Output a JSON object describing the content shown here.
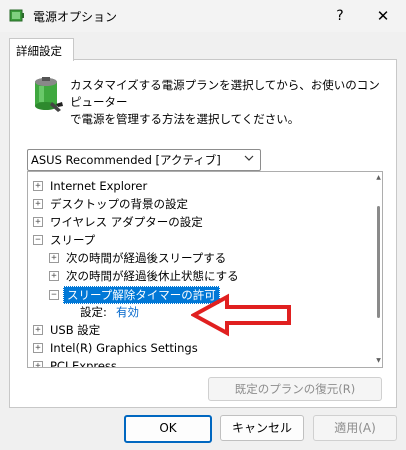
{
  "window": {
    "title": "電源オプション",
    "help_glyph": "?",
    "close_glyph": "✕"
  },
  "tab": {
    "label": "詳細設定"
  },
  "description": {
    "line1": "カスタマイズする電源プランを選択してから、お使いのコンピューター",
    "line2": "で電源を管理する方法を選択してください。"
  },
  "plan_select": {
    "value": "ASUS Recommended [アクティブ]"
  },
  "tree": {
    "items": [
      {
        "label": "Internet Explorer",
        "expander": "+"
      },
      {
        "label": "デスクトップの背景の設定",
        "expander": "+"
      },
      {
        "label": "ワイヤレス アダプターの設定",
        "expander": "+"
      },
      {
        "label": "スリープ",
        "expander": "−"
      },
      {
        "label": "次の時間が経過後スリープする",
        "expander": "+"
      },
      {
        "label": "次の時間が経過後休止状態にする",
        "expander": "+"
      },
      {
        "label": "スリープ解除タイマーの許可",
        "expander": "−"
      },
      {
        "label": "設定:",
        "value": "有効"
      },
      {
        "label": "USB 設定",
        "expander": "+"
      },
      {
        "label": "Intel(R) Graphics Settings",
        "expander": "+"
      },
      {
        "label": "PCI Express",
        "expander": "+"
      }
    ]
  },
  "buttons": {
    "restore": "既定のプランの復元(R)",
    "ok": "OK",
    "cancel": "キャンセル",
    "apply": "適用(A)"
  },
  "colors": {
    "selection": "#0078d7",
    "arrow": "#e02020",
    "link": "#0066cc"
  }
}
